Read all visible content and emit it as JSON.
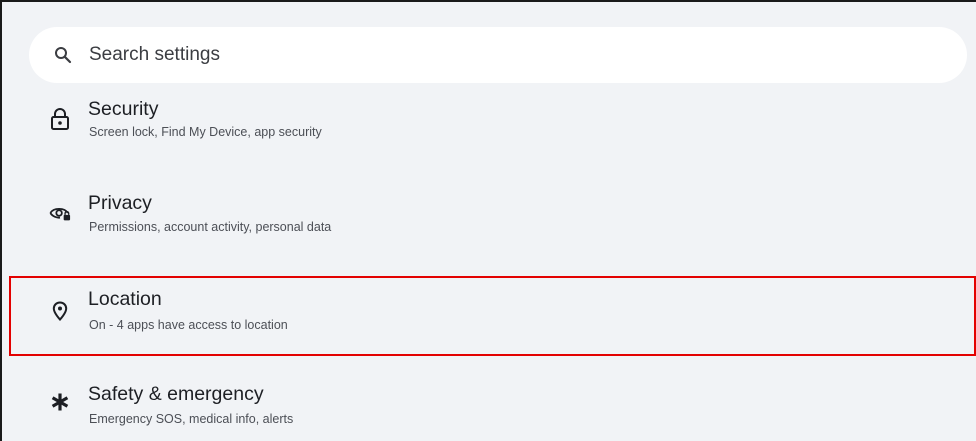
{
  "search": {
    "placeholder": "Search settings",
    "icon": "search-icon"
  },
  "items": [
    {
      "title": "Security",
      "subtitle": "Screen lock, Find My Device, app security",
      "icon": "lock-icon"
    },
    {
      "title": "Privacy",
      "subtitle": "Permissions, account activity, personal data",
      "icon": "privacy-eye-icon"
    },
    {
      "title": "Location",
      "subtitle": "On - 4 apps have access to location",
      "icon": "location-pin-icon"
    },
    {
      "title": "Safety & emergency",
      "subtitle": "Emergency SOS, medical info, alerts",
      "icon": "asterisk-icon"
    }
  ],
  "colors": {
    "background": "#f1f3f6",
    "highlight": "#e30000"
  }
}
